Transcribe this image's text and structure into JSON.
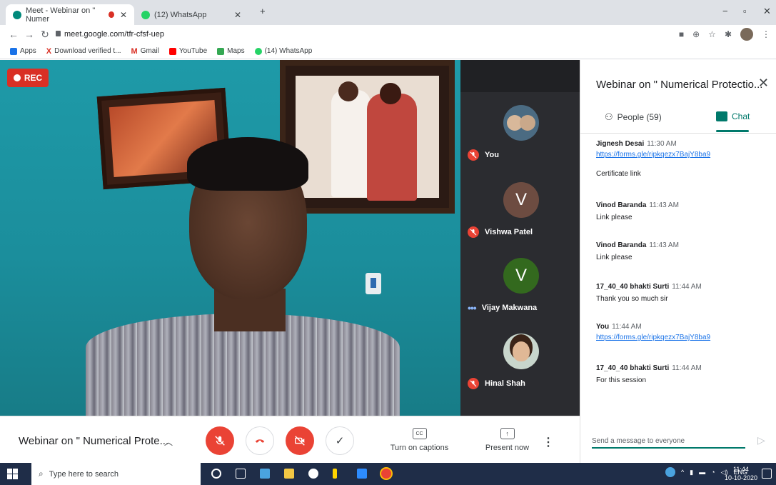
{
  "browser": {
    "tabs": [
      {
        "title": "Meet - Webinar on \" Numer",
        "active": true
      },
      {
        "title": "(12) WhatsApp",
        "active": false
      }
    ],
    "new_tab": "+",
    "url": "meet.google.com/tfr-cfsf-uep",
    "bookmarks": [
      {
        "label": "Apps",
        "icon": "apps-grid-icon"
      },
      {
        "label": "Download verified t...",
        "icon": "x-logo-icon"
      },
      {
        "label": "Gmail",
        "icon": "gmail-icon"
      },
      {
        "label": "YouTube",
        "icon": "youtube-icon"
      },
      {
        "label": "Maps",
        "icon": "maps-icon"
      },
      {
        "label": "(14) WhatsApp",
        "icon": "whatsapp-icon"
      }
    ]
  },
  "video": {
    "rec_label": "REC"
  },
  "participants": [
    {
      "name": "You",
      "status": "muted",
      "avatar_letter": "",
      "avatar_color": "#4b6b82"
    },
    {
      "name": "Vishwa Patel",
      "status": "muted",
      "avatar_letter": "V",
      "avatar_color": "#6d4c41"
    },
    {
      "name": "Vijay Makwana",
      "status": "speaking",
      "avatar_letter": "V",
      "avatar_color": "#33691e"
    },
    {
      "name": "Hinal Shah",
      "status": "muted",
      "avatar_letter": "",
      "avatar_color": "#c8d6cc"
    }
  ],
  "controls": {
    "meeting_title": "Webinar on \" Numerical Prote...",
    "captions_label": "Turn on captions",
    "captions_icon_text": "CC",
    "present_label": "Present now",
    "colors": {
      "danger": "#ea4335",
      "accent": "#00796b"
    }
  },
  "panel": {
    "title": "Webinar on \" Numerical Protectio...",
    "people_tab": "People (59)",
    "chat_tab": "Chat",
    "messages": [
      {
        "sender": "Jignesh Desai",
        "time": "11:30 AM",
        "link": "https://forms.gle/ripkqezx7BajY8ba9",
        "text": "",
        "extra": "Certificate link"
      },
      {
        "sender": "Vinod Baranda",
        "time": "11:43 AM",
        "link": "",
        "text": "Link please",
        "extra": ""
      },
      {
        "sender": "Vinod Baranda",
        "time": "11:43 AM",
        "link": "",
        "text": "Link please",
        "extra": ""
      },
      {
        "sender": "17_40_40 bhakti Surti",
        "time": "11:44 AM",
        "link": "",
        "text": "Thank you so much sir",
        "extra": ""
      },
      {
        "sender": "You",
        "time": "11:44 AM",
        "link": "https://forms.gle/ripkqezx7BajY8ba9",
        "text": "",
        "extra": ""
      },
      {
        "sender": "17_40_40 bhakti Surti",
        "time": "11:44 AM",
        "link": "",
        "text": "For this session",
        "extra": ""
      }
    ],
    "compose_placeholder": "Send a message to everyone"
  },
  "taskbar": {
    "search_placeholder": "Type here to search",
    "lang": "ENG",
    "time": "11:44",
    "date": "10-10-2020"
  }
}
